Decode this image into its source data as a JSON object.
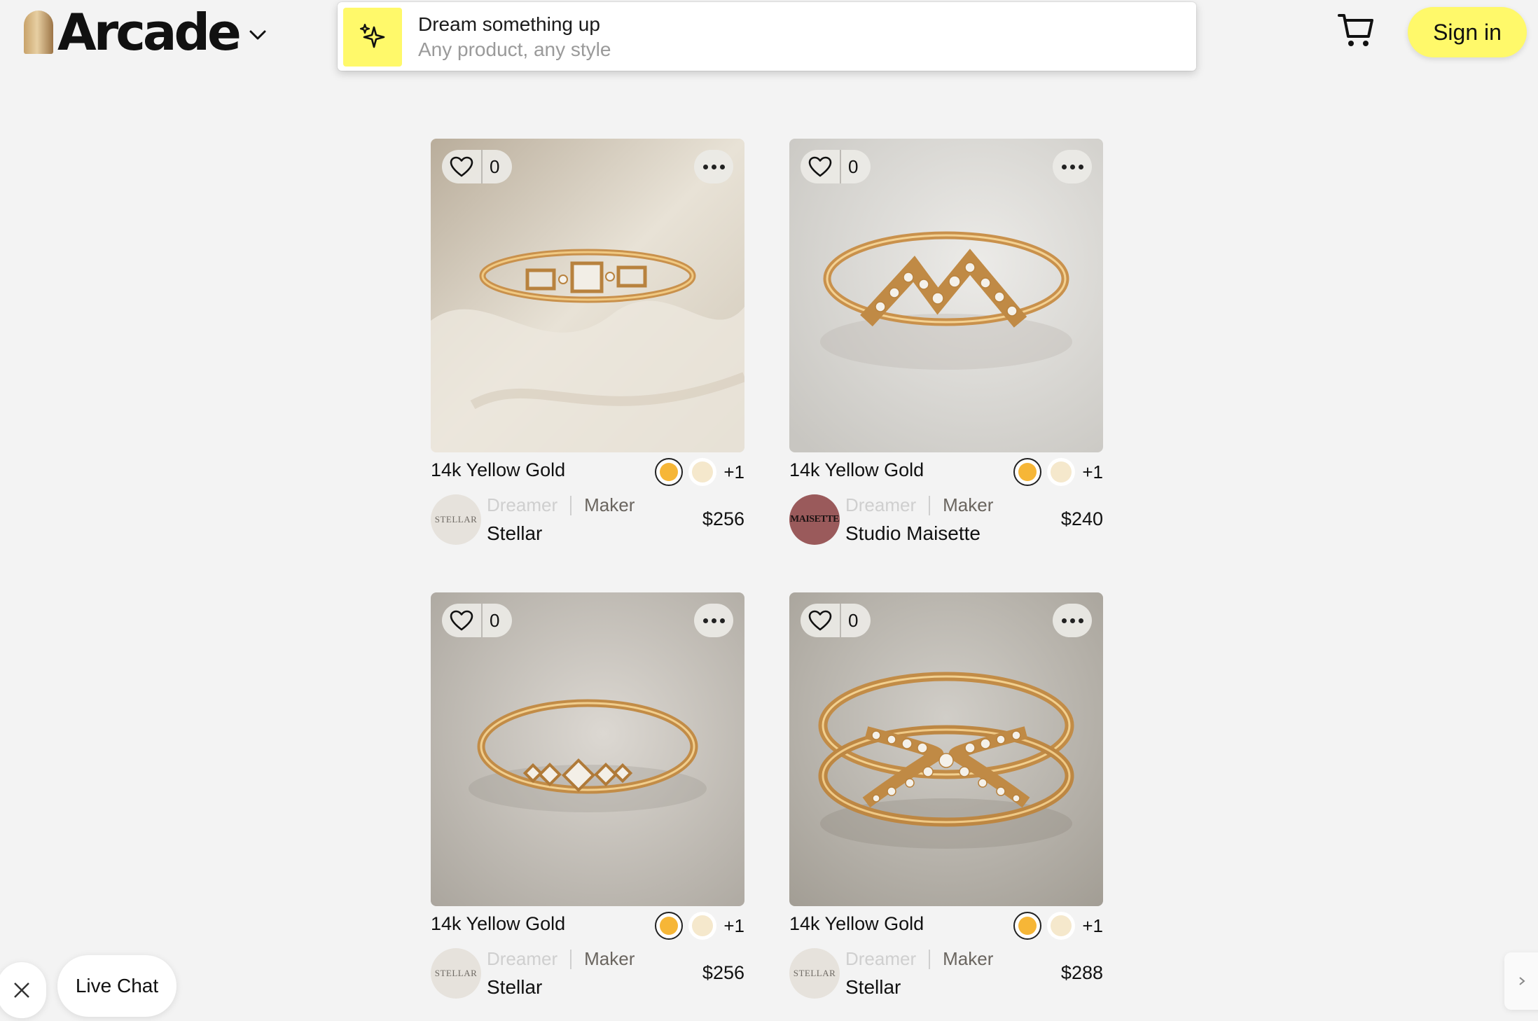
{
  "header": {
    "brand": "Arcade",
    "search_title": "Dream something up",
    "search_subtitle": "Any product, any style",
    "signin_label": "Sign in"
  },
  "products": [
    {
      "title": "14k Yellow Gold",
      "likes": "0",
      "extra_colors": "+1",
      "swatches": [
        "#f6b637",
        "#f5e8cc"
      ],
      "role_dreamer": "Dreamer",
      "role_maker": "Maker",
      "maker": "Stellar",
      "avatar_text": "STELLAR",
      "price": "$256"
    },
    {
      "title": "14k Yellow Gold",
      "likes": "0",
      "extra_colors": "+1",
      "swatches": [
        "#f6b637",
        "#f5e8cc"
      ],
      "role_dreamer": "Dreamer",
      "role_maker": "Maker",
      "maker": "Studio Maisette",
      "avatar_text": "MAISETTE",
      "price": "$240"
    },
    {
      "title": "14k Yellow Gold",
      "likes": "0",
      "extra_colors": "+1",
      "swatches": [
        "#f6b637",
        "#f5e8cc"
      ],
      "role_dreamer": "Dreamer",
      "role_maker": "Maker",
      "maker": "Stellar",
      "avatar_text": "STELLAR",
      "price": "$256"
    },
    {
      "title": "14k Yellow Gold",
      "likes": "0",
      "extra_colors": "+1",
      "swatches": [
        "#f6b637",
        "#f5e8cc"
      ],
      "role_dreamer": "Dreamer",
      "role_maker": "Maker",
      "maker": "Stellar",
      "avatar_text": "STELLAR",
      "price": "$288"
    }
  ],
  "chat": {
    "label": "Live Chat"
  },
  "colors": {
    "accent_yellow": "#fff96a",
    "background": "#f3f3f3"
  }
}
